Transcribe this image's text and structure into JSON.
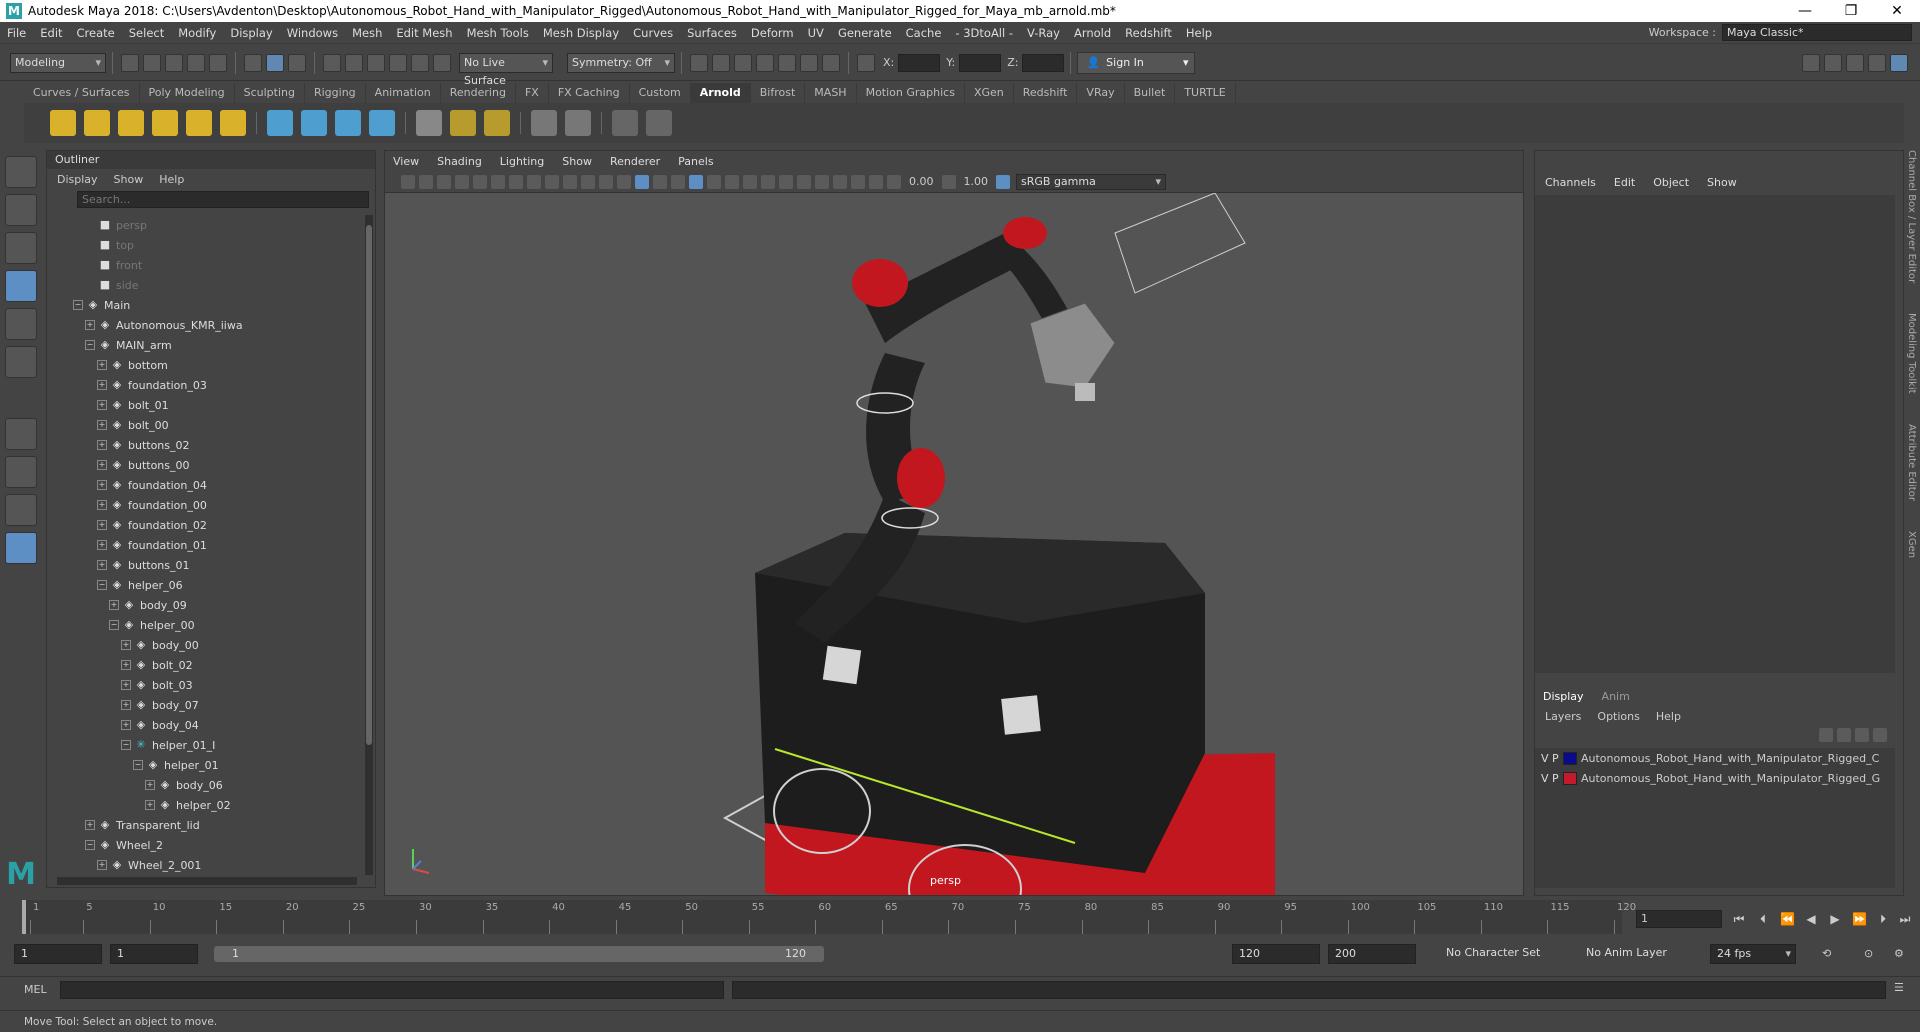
{
  "window": {
    "title": "Autodesk Maya 2018: C:\\Users\\Avdenton\\Desktop\\Autonomous_Robot_Hand_with_Manipulator_Rigged\\Autonomous_Robot_Hand_with_Manipulator_Rigged_for_Maya_mb_arnold.mb*",
    "minimize": "—",
    "maximize": "❐",
    "close": "✕"
  },
  "menubar": {
    "items": [
      "File",
      "Edit",
      "Create",
      "Select",
      "Modify",
      "Display",
      "Windows",
      "Mesh",
      "Edit Mesh",
      "Mesh Tools",
      "Mesh Display",
      "Curves",
      "Surfaces",
      "Deform",
      "UV",
      "Generate",
      "Cache",
      "- 3DtoAll -",
      "V-Ray",
      "Arnold",
      "Redshift",
      "Help"
    ],
    "workspace_label": "Workspace :",
    "workspace_value": "Maya Classic*"
  },
  "statusline": {
    "mode": "Modeling",
    "live_surface": "No Live Surface",
    "symmetry": "Symmetry: Off",
    "x_label": "X:",
    "y_label": "Y:",
    "z_label": "Z:",
    "sign_in": "Sign In"
  },
  "shelf": {
    "tabs": [
      "Curves / Surfaces",
      "Poly Modeling",
      "Sculpting",
      "Rigging",
      "Animation",
      "Rendering",
      "FX",
      "FX Caching",
      "Custom",
      "Arnold",
      "Bifrost",
      "MASH",
      "Motion Graphics",
      "XGen",
      "Redshift",
      "VRay",
      "Bullet",
      "TURTLE"
    ],
    "active_tab": "Arnold"
  },
  "outliner": {
    "title": "Outliner",
    "menus": [
      "Display",
      "Show",
      "Help"
    ],
    "search_placeholder": "Search...",
    "nodes": [
      {
        "label": "persp",
        "depth": 1,
        "type": "camera",
        "expander": ""
      },
      {
        "label": "top",
        "depth": 1,
        "type": "camera",
        "expander": ""
      },
      {
        "label": "front",
        "depth": 1,
        "type": "camera",
        "expander": ""
      },
      {
        "label": "side",
        "depth": 1,
        "type": "camera",
        "expander": ""
      },
      {
        "label": "Main",
        "depth": 0,
        "type": "group",
        "expander": "−"
      },
      {
        "label": "Autonomous_KMR_iiwa",
        "depth": 1,
        "type": "group",
        "expander": "+"
      },
      {
        "label": "MAIN_arm",
        "depth": 1,
        "type": "group",
        "expander": "−"
      },
      {
        "label": "bottom",
        "depth": 2,
        "type": "group",
        "expander": "+"
      },
      {
        "label": "foundation_03",
        "depth": 2,
        "type": "group",
        "expander": "+"
      },
      {
        "label": "bolt_01",
        "depth": 2,
        "type": "group",
        "expander": "+"
      },
      {
        "label": "bolt_00",
        "depth": 2,
        "type": "group",
        "expander": "+"
      },
      {
        "label": "buttons_02",
        "depth": 2,
        "type": "group",
        "expander": "+"
      },
      {
        "label": "buttons_00",
        "depth": 2,
        "type": "group",
        "expander": "+"
      },
      {
        "label": "foundation_04",
        "depth": 2,
        "type": "group",
        "expander": "+"
      },
      {
        "label": "foundation_00",
        "depth": 2,
        "type": "group",
        "expander": "+"
      },
      {
        "label": "foundation_02",
        "depth": 2,
        "type": "group",
        "expander": "+"
      },
      {
        "label": "foundation_01",
        "depth": 2,
        "type": "group",
        "expander": "+"
      },
      {
        "label": "buttons_01",
        "depth": 2,
        "type": "group",
        "expander": "+"
      },
      {
        "label": "helper_06",
        "depth": 2,
        "type": "group",
        "expander": "−"
      },
      {
        "label": "body_09",
        "depth": 3,
        "type": "group",
        "expander": "+"
      },
      {
        "label": "helper_00",
        "depth": 3,
        "type": "group",
        "expander": "−"
      },
      {
        "label": "body_00",
        "depth": 4,
        "type": "group",
        "expander": "+"
      },
      {
        "label": "bolt_02",
        "depth": 4,
        "type": "group",
        "expander": "+"
      },
      {
        "label": "bolt_03",
        "depth": 4,
        "type": "group",
        "expander": "+"
      },
      {
        "label": "body_07",
        "depth": 4,
        "type": "group",
        "expander": "+"
      },
      {
        "label": "body_04",
        "depth": 4,
        "type": "group",
        "expander": "+"
      },
      {
        "label": "helper_01_I",
        "depth": 4,
        "type": "ik",
        "expander": "−"
      },
      {
        "label": "helper_01",
        "depth": 5,
        "type": "group",
        "expander": "−"
      },
      {
        "label": "body_06",
        "depth": 6,
        "type": "group",
        "expander": "+"
      },
      {
        "label": "helper_02",
        "depth": 6,
        "type": "group",
        "expander": "+"
      },
      {
        "label": "Transparent_lid",
        "depth": 1,
        "type": "group",
        "expander": "+"
      },
      {
        "label": "Wheel_2",
        "depth": 1,
        "type": "group",
        "expander": "−"
      },
      {
        "label": "Wheel_2_001",
        "depth": 2,
        "type": "group",
        "expander": "+"
      }
    ]
  },
  "viewport": {
    "menus": [
      "View",
      "Shading",
      "Lighting",
      "Show",
      "Renderer",
      "Panels"
    ],
    "exposure": "0.00",
    "gamma": "1.00",
    "color_space": "sRGB gamma",
    "camera": "persp",
    "robot_body_color": "#1d1d1d",
    "robot_accent_color": "#c2171f"
  },
  "channelbox": {
    "menus": [
      "Channels",
      "Edit",
      "Object",
      "Show"
    ],
    "layer_tabs": [
      "Display",
      "Anim"
    ],
    "layer_menus": [
      "Layers",
      "Options",
      "Help"
    ],
    "layers": [
      {
        "v": "V",
        "p": "P",
        "color": "#0a0a8c",
        "name": "Autonomous_Robot_Hand_with_Manipulator_Rigged_C"
      },
      {
        "v": "V",
        "p": "P",
        "color": "#c41a2e",
        "name": "Autonomous_Robot_Hand_with_Manipulator_Rigged_G"
      }
    ],
    "side_tabs": [
      "Channel Box / Layer Editor",
      "Modeling Toolkit",
      "Attribute Editor",
      "XGen"
    ]
  },
  "timeline": {
    "ticks": [
      1,
      5,
      10,
      15,
      20,
      25,
      30,
      35,
      40,
      45,
      50,
      55,
      60,
      65,
      70,
      75,
      80,
      85,
      90,
      95,
      100,
      105,
      110,
      115,
      120
    ],
    "current_frame": "1"
  },
  "range": {
    "start_outer": "1",
    "start_inner": "1",
    "slider_start": "1",
    "slider_end": "120",
    "end_inner": "120",
    "end_outer": "200",
    "character_set": "No Character Set",
    "anim_layer": "No Anim Layer",
    "fps": "24 fps"
  },
  "cmdline": {
    "label": "MEL"
  },
  "helpline": {
    "text": "Move Tool: Select an object to move."
  }
}
